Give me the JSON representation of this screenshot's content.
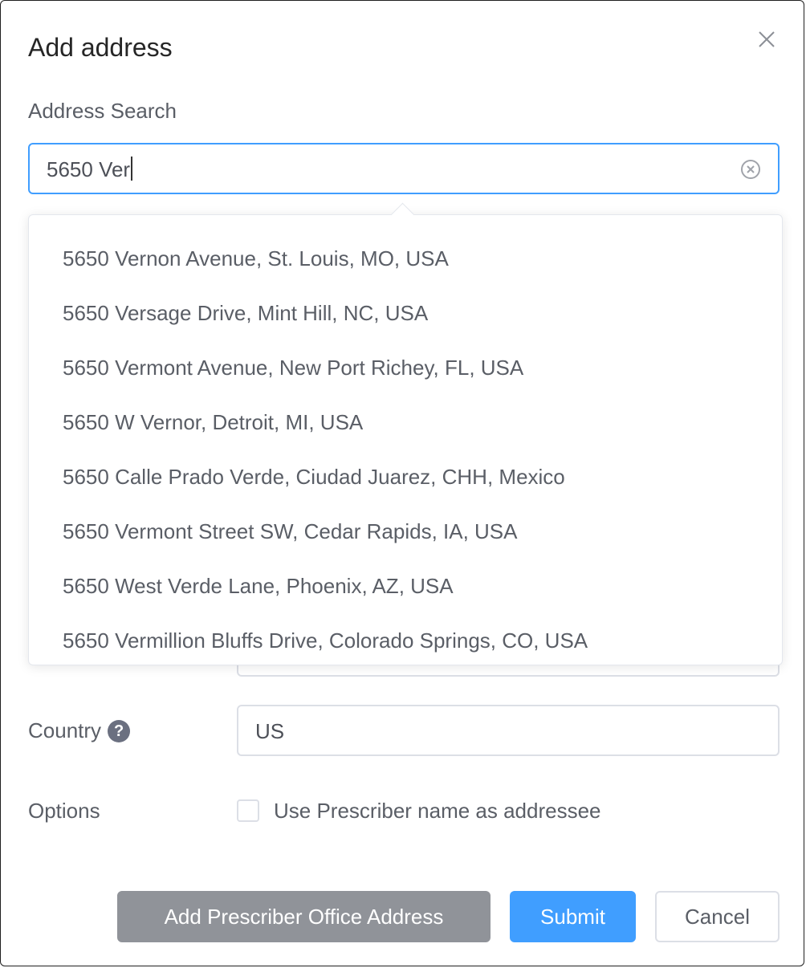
{
  "dialog": {
    "title": "Add address"
  },
  "search": {
    "label": "Address Search",
    "value": "5650 Ver"
  },
  "suggestions": [
    "5650 Vernon Avenue, St. Louis, MO, USA",
    "5650 Versage Drive, Mint Hill, NC, USA",
    "5650 Vermont Avenue, New Port Richey, FL, USA",
    "5650 W Vernor, Detroit, MI, USA",
    "5650 Calle Prado Verde, Ciudad Juarez, CHH, Mexico",
    "5650 Vermont Street SW, Cedar Rapids, IA, USA",
    "5650 West Verde Lane, Phoenix, AZ, USA",
    "5650 Vermillion Bluffs Drive, Colorado Springs, CO, USA"
  ],
  "country": {
    "label": "Country",
    "help_icon": "question-circle-icon",
    "help_glyph": "?",
    "value": "US"
  },
  "options": {
    "label": "Options",
    "checkbox_label": "Use Prescriber name as addressee",
    "checked": false
  },
  "buttons": {
    "office": "Add Prescriber Office Address",
    "submit": "Submit",
    "cancel": "Cancel"
  },
  "colors": {
    "primary": "#409eff",
    "secondary_button": "#909399",
    "text": "#5a5e66"
  }
}
